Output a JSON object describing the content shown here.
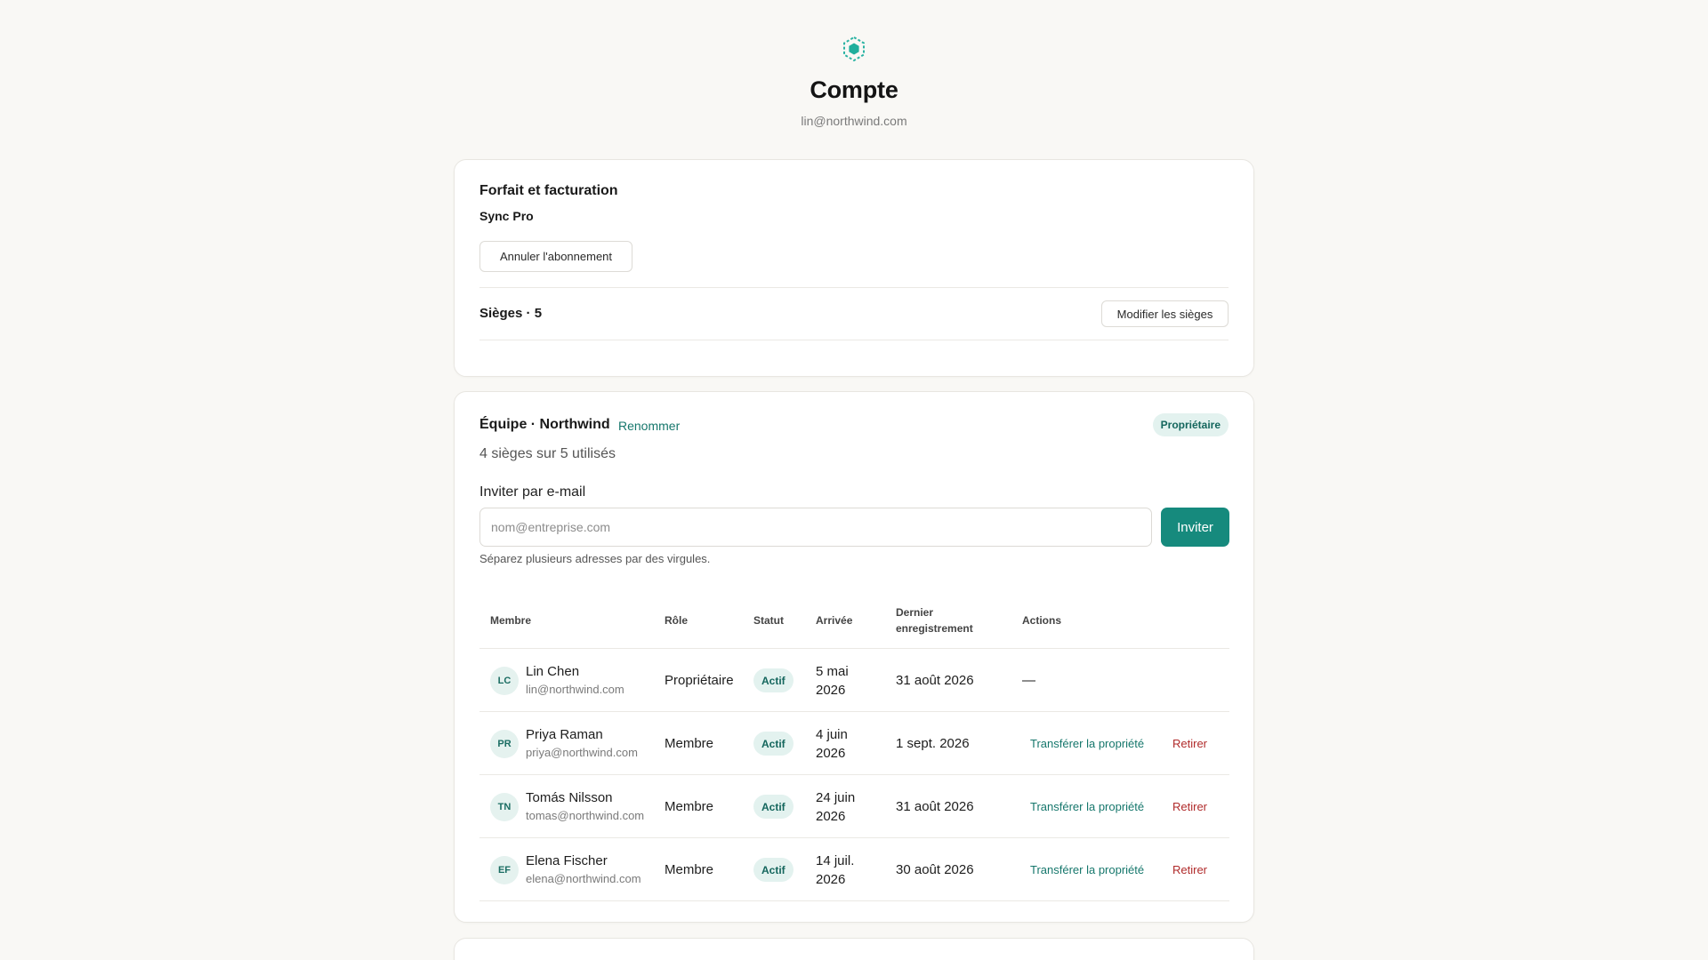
{
  "header": {
    "logo_icon": "hexagon-logo-icon",
    "title": "Compte",
    "email": "lin@northwind.com"
  },
  "billing": {
    "title": "Forfait et facturation",
    "plan": "Sync Pro",
    "cancel_label": "Annuler l'abonnement",
    "seats_label": "Sièges · 5",
    "modify_seats_label": "Modifier les sièges"
  },
  "team": {
    "title": "Équipe · Northwind",
    "rename_label": "Renommer",
    "role_badge": "Propriétaire",
    "seats_used": "4 sièges sur 5 utilisés",
    "invite_label": "Inviter par e-mail",
    "invite_placeholder": "nom@entreprise.com",
    "invite_button": "Inviter",
    "invite_hint": "Séparez plusieurs adresses par des virgules.",
    "columns": {
      "member": "Membre",
      "role": "Rôle",
      "status": "Statut",
      "arrival": "Arrivée",
      "last_checkin": "Dernier enregistrement",
      "actions": "Actions"
    },
    "members": [
      {
        "initials": "LC",
        "name": "Lin Chen",
        "email": "lin@northwind.com",
        "role": "Propriétaire",
        "status": "Actif",
        "arrival": "5 mai 2026",
        "last": "31 août 2026",
        "actions": "—"
      },
      {
        "initials": "PR",
        "name": "Priya Raman",
        "email": "priya@northwind.com",
        "role": "Membre",
        "status": "Actif",
        "arrival": "4 juin 2026",
        "last": "1 sept. 2026",
        "transfer": "Transférer la propriété",
        "remove": "Retirer"
      },
      {
        "initials": "TN",
        "name": "Tomás Nilsson",
        "email": "tomas@northwind.com",
        "role": "Membre",
        "status": "Actif",
        "arrival": "24 juin 2026",
        "last": "31 août 2026",
        "transfer": "Transférer la propriété",
        "remove": "Retirer"
      },
      {
        "initials": "EF",
        "name": "Elena Fischer",
        "email": "elena@northwind.com",
        "role": "Membre",
        "status": "Actif",
        "arrival": "14 juil. 2026",
        "last": "30 août 2026",
        "transfer": "Transférer la propriété",
        "remove": "Retirer"
      }
    ]
  },
  "colors": {
    "accent": "#168a7d",
    "danger": "#b02a2a",
    "background": "#f9f8f5"
  }
}
